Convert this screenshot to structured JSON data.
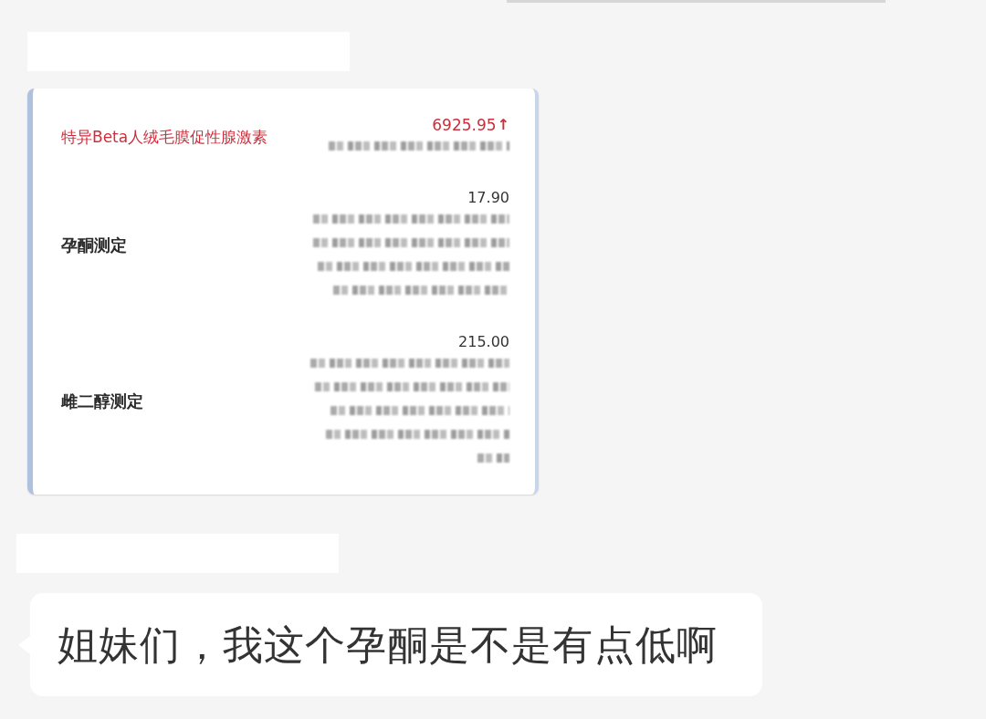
{
  "chat": {
    "messages": [
      {
        "kind": "image",
        "sender_hidden": true,
        "report": {
          "items": [
            {
              "name": "特异Beta人绒毛膜促性腺激素",
              "value": "6925.95",
              "flag": "↑",
              "abnormal": true
            },
            {
              "name": "孕酮测定",
              "value": "17.90",
              "abnormal": false
            },
            {
              "name": "雌二醇测定",
              "value": "215.00",
              "abnormal": false
            }
          ]
        }
      },
      {
        "kind": "text",
        "sender_hidden": true,
        "text": "姐妹们，我这个孕酮是不是有点低啊"
      }
    ]
  }
}
